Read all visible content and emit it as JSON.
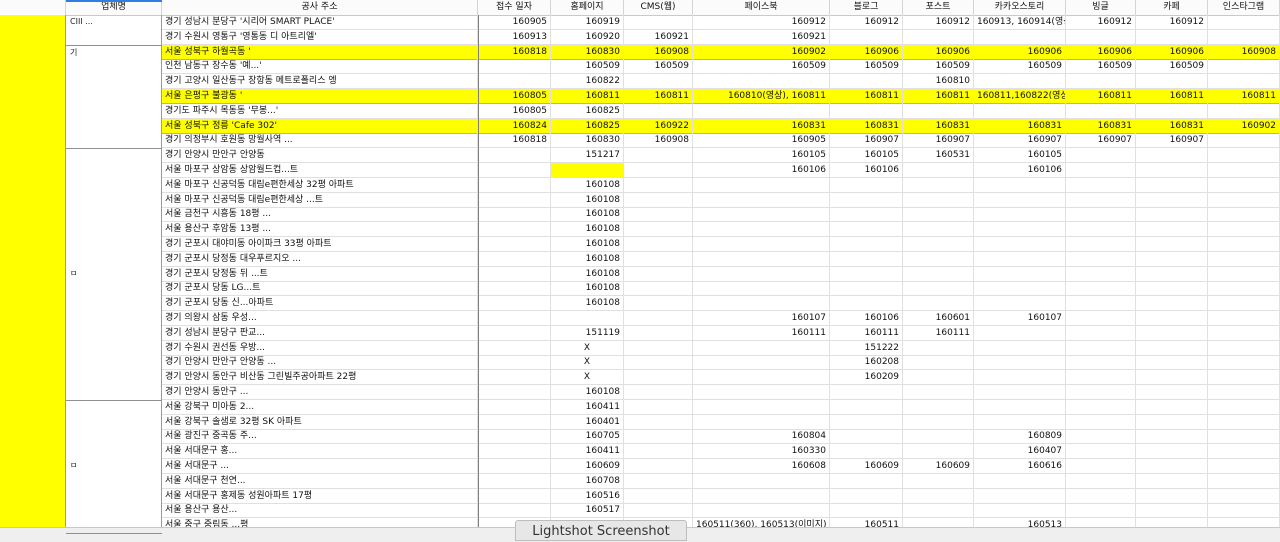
{
  "headers": [
    "업체명",
    "공사 주소",
    "접수 일자",
    "홈페이지",
    "CMS(웹)",
    "페이스북",
    "블로그",
    "포스트",
    "카카오스토리",
    "빙글",
    "카페",
    "인스타그램"
  ],
  "blocks": [
    {
      "label": "CIII ...",
      "rows": [
        0,
        1
      ]
    },
    {
      "label": "기",
      "rows": [
        2,
        8
      ]
    },
    {
      "label": "ㅁ",
      "rows": [
        9,
        25
      ]
    },
    {
      "label": "ㅁ",
      "rows": [
        26,
        34
      ]
    }
  ],
  "rows": [
    {
      "hl": false,
      "addr": "경기 성남시 분당구 '시리어 SMART PLACE'",
      "date": "160905",
      "home": "160919",
      "cms": "",
      "fb": "160912",
      "blog": "160912",
      "post": "160912",
      "kakao": "160913, 160914(영상)",
      "vingle": "160912",
      "cafe": "160912",
      "insta": ""
    },
    {
      "hl": false,
      "addr": "경기 수원시 영통구 '영통동 디 아트리엘'",
      "date": "160913",
      "home": "160920",
      "cms": "160921",
      "fb": "160921",
      "blog": "",
      "post": "",
      "kakao": "",
      "vingle": "",
      "cafe": "",
      "insta": ""
    },
    {
      "hl": true,
      "addr": "서울 성북구 하월곡동 '",
      "date": "160818",
      "home": "160830",
      "cms": "160908",
      "fb": "160902",
      "blog": "160906",
      "post": "160906",
      "kakao": "160906",
      "vingle": "160906",
      "cafe": "160906",
      "insta": "160908"
    },
    {
      "hl": false,
      "addr": "인천 남동구 장수동 '예...'",
      "date": "",
      "home": "160509",
      "cms": "160509",
      "fb": "160509",
      "blog": "160509",
      "post": "160509",
      "kakao": "160509",
      "vingle": "160509",
      "cafe": "160509",
      "insta": ""
    },
    {
      "hl": false,
      "addr": "경기 고양시 일산동구 장항동 메트로폴리스 엥",
      "date": "",
      "home": "160822",
      "cms": "",
      "fb": "",
      "blog": "",
      "post": "160810",
      "kakao": "",
      "vingle": "",
      "cafe": "",
      "insta": ""
    },
    {
      "hl": true,
      "addr": "서울 은평구 불광동 '",
      "date": "160805",
      "home": "160811",
      "cms": "160811",
      "fb": "160810(영상), 160811",
      "blog": "160811",
      "post": "160811",
      "kakao": "160811,160822(영상)",
      "vingle": "160811",
      "cafe": "160811",
      "insta": "160811"
    },
    {
      "hl": false,
      "addr": "경기도 파주시 목동동 '무봉...'",
      "date": "160805",
      "home": "160825",
      "cms": "",
      "fb": "",
      "blog": "",
      "post": "",
      "kakao": "",
      "vingle": "",
      "cafe": "",
      "insta": ""
    },
    {
      "hl": true,
      "addr": "서울 성북구 정릉 'Cafe 302'",
      "date": "160824",
      "home": "160825",
      "cms": "160922",
      "fb": "160831",
      "blog": "160831",
      "post": "160831",
      "kakao": "160831",
      "vingle": "160831",
      "cafe": "160831",
      "insta": "160902"
    },
    {
      "hl": false,
      "addr": "경기 의정부시 호원동 망월사역 ...",
      "date": "160818",
      "home": "160830",
      "cms": "160908",
      "fb": "160905",
      "blog": "160907",
      "post": "160907",
      "kakao": "160907",
      "vingle": "160907",
      "cafe": "160907",
      "insta": ""
    },
    {
      "hl": false,
      "addr": "경기 안양시 만안구 안양동",
      "date": "",
      "home": "151217",
      "cms": "",
      "fb": "160105",
      "blog": "160105",
      "post": "160531",
      "kakao": "160105",
      "vingle": "",
      "cafe": "",
      "insta": ""
    },
    {
      "hl": false,
      "addr": "서울 마포구 상암동 상암월드컵...트",
      "date": "",
      "home": "",
      "cms": "",
      "fb": "160106",
      "blog": "160106",
      "post": "",
      "kakao": "160106",
      "vingle": "",
      "cafe": "",
      "insta": "",
      "yhome": true
    },
    {
      "hl": false,
      "addr": "서울 마포구 신공덕동 대림e편한세상 32평 아파트",
      "date": "",
      "home": "160108",
      "cms": "",
      "fb": "",
      "blog": "",
      "post": "",
      "kakao": "",
      "vingle": "",
      "cafe": "",
      "insta": ""
    },
    {
      "hl": false,
      "addr": "서울 마포구 신공덕동 대림e편한세상 ...트",
      "date": "",
      "home": "160108",
      "cms": "",
      "fb": "",
      "blog": "",
      "post": "",
      "kakao": "",
      "vingle": "",
      "cafe": "",
      "insta": ""
    },
    {
      "hl": false,
      "addr": "서울 금천구 시흥동 18평 ...",
      "date": "",
      "home": "160108",
      "cms": "",
      "fb": "",
      "blog": "",
      "post": "",
      "kakao": "",
      "vingle": "",
      "cafe": "",
      "insta": ""
    },
    {
      "hl": false,
      "addr": "서울 용산구 후암동 13평 ...",
      "date": "",
      "home": "160108",
      "cms": "",
      "fb": "",
      "blog": "",
      "post": "",
      "kakao": "",
      "vingle": "",
      "cafe": "",
      "insta": ""
    },
    {
      "hl": false,
      "addr": "경기 군포시 대야미동 아이파크 33평 아파트",
      "date": "",
      "home": "160108",
      "cms": "",
      "fb": "",
      "blog": "",
      "post": "",
      "kakao": "",
      "vingle": "",
      "cafe": "",
      "insta": ""
    },
    {
      "hl": false,
      "addr": "경기 군포시 당정동 대우푸르지오 ...",
      "date": "",
      "home": "160108",
      "cms": "",
      "fb": "",
      "blog": "",
      "post": "",
      "kakao": "",
      "vingle": "",
      "cafe": "",
      "insta": ""
    },
    {
      "hl": false,
      "addr": "경기 군포시 당정동 뒤 ...트",
      "date": "",
      "home": "160108",
      "cms": "",
      "fb": "",
      "blog": "",
      "post": "",
      "kakao": "",
      "vingle": "",
      "cafe": "",
      "insta": ""
    },
    {
      "hl": false,
      "addr": "경기 군포시 당동 LG...트",
      "date": "",
      "home": "160108",
      "cms": "",
      "fb": "",
      "blog": "",
      "post": "",
      "kakao": "",
      "vingle": "",
      "cafe": "",
      "insta": ""
    },
    {
      "hl": false,
      "addr": "경기 군포시 당동 신...아파트",
      "date": "",
      "home": "160108",
      "cms": "",
      "fb": "",
      "blog": "",
      "post": "",
      "kakao": "",
      "vingle": "",
      "cafe": "",
      "insta": ""
    },
    {
      "hl": false,
      "addr": "경기 의왕시 삼동 우성...",
      "date": "",
      "home": "",
      "cms": "",
      "fb": "160107",
      "blog": "160106",
      "post": "160601",
      "kakao": "160107",
      "vingle": "",
      "cafe": "",
      "insta": ""
    },
    {
      "hl": false,
      "addr": "경기 성남시 분당구 판교...",
      "date": "",
      "home": "151119",
      "cms": "",
      "fb": "160111",
      "blog": "160111",
      "post": "160111",
      "kakao": "",
      "vingle": "",
      "cafe": "",
      "insta": ""
    },
    {
      "hl": false,
      "addr": "경기 수원시 권선동 우방...",
      "date": "",
      "home": "X",
      "cms": "",
      "fb": "",
      "blog": "151222",
      "post": "",
      "kakao": "",
      "vingle": "",
      "cafe": "",
      "insta": "",
      "xhome": true
    },
    {
      "hl": false,
      "addr": "경기 안양시 만안구 안양동 ...",
      "date": "",
      "home": "X",
      "cms": "",
      "fb": "",
      "blog": "160208",
      "post": "",
      "kakao": "",
      "vingle": "",
      "cafe": "",
      "insta": "",
      "xhome": true
    },
    {
      "hl": false,
      "addr": "경기 안양시 동안구 비산동 그린빌주공아파트 22평",
      "date": "",
      "home": "X",
      "cms": "",
      "fb": "",
      "blog": "160209",
      "post": "",
      "kakao": "",
      "vingle": "",
      "cafe": "",
      "insta": "",
      "xhome": true
    },
    {
      "hl": false,
      "addr": "경기 안양시 동안구 ...",
      "date": "",
      "home": "160108",
      "cms": "",
      "fb": "",
      "blog": "",
      "post": "",
      "kakao": "",
      "vingle": "",
      "cafe": "",
      "insta": ""
    },
    {
      "hl": false,
      "addr": "서울 강북구 미아동 2...",
      "date": "",
      "home": "160411",
      "cms": "",
      "fb": "",
      "blog": "",
      "post": "",
      "kakao": "",
      "vingle": "",
      "cafe": "",
      "insta": ""
    },
    {
      "hl": false,
      "addr": "서울 강북구 솔샘로 32평 SK 아파트",
      "date": "",
      "home": "160401",
      "cms": "",
      "fb": "",
      "blog": "",
      "post": "",
      "kakao": "",
      "vingle": "",
      "cafe": "",
      "insta": ""
    },
    {
      "hl": false,
      "addr": "서울 광진구 중곡동 주...",
      "date": "",
      "home": "160705",
      "cms": "",
      "fb": "160804",
      "blog": "",
      "post": "",
      "kakao": "160809",
      "vingle": "",
      "cafe": "",
      "insta": ""
    },
    {
      "hl": false,
      "addr": "서울 서대문구 홍...",
      "date": "",
      "home": "160411",
      "cms": "",
      "fb": "160330",
      "blog": "",
      "post": "",
      "kakao": "160407",
      "vingle": "",
      "cafe": "",
      "insta": ""
    },
    {
      "hl": false,
      "addr": "서울 서대문구 ...",
      "date": "",
      "home": "160609",
      "cms": "",
      "fb": "160608",
      "blog": "160609",
      "post": "160609",
      "kakao": "160616",
      "vingle": "",
      "cafe": "",
      "insta": ""
    },
    {
      "hl": false,
      "addr": "서울 서대문구 천연...",
      "date": "",
      "home": "160708",
      "cms": "",
      "fb": "",
      "blog": "",
      "post": "",
      "kakao": "",
      "vingle": "",
      "cafe": "",
      "insta": ""
    },
    {
      "hl": false,
      "addr": "서울 서대문구 홍제동 성원아파트 17평",
      "date": "",
      "home": "160516",
      "cms": "",
      "fb": "",
      "blog": "",
      "post": "",
      "kakao": "",
      "vingle": "",
      "cafe": "",
      "insta": ""
    },
    {
      "hl": false,
      "addr": "서울 용산구 용산...",
      "date": "",
      "home": "160517",
      "cms": "",
      "fb": "",
      "blog": "",
      "post": "",
      "kakao": "",
      "vingle": "",
      "cafe": "",
      "insta": ""
    },
    {
      "hl": false,
      "addr": "서울 중구 중림동 ...평",
      "date": "",
      "home": "",
      "cms": "",
      "fb": "160511(360), 160513(이미지)",
      "blog": "160511",
      "post": "",
      "kakao": "160513",
      "vingle": "",
      "cafe": "",
      "insta": ""
    }
  ],
  "tooltip": "Lightshot Screenshot"
}
